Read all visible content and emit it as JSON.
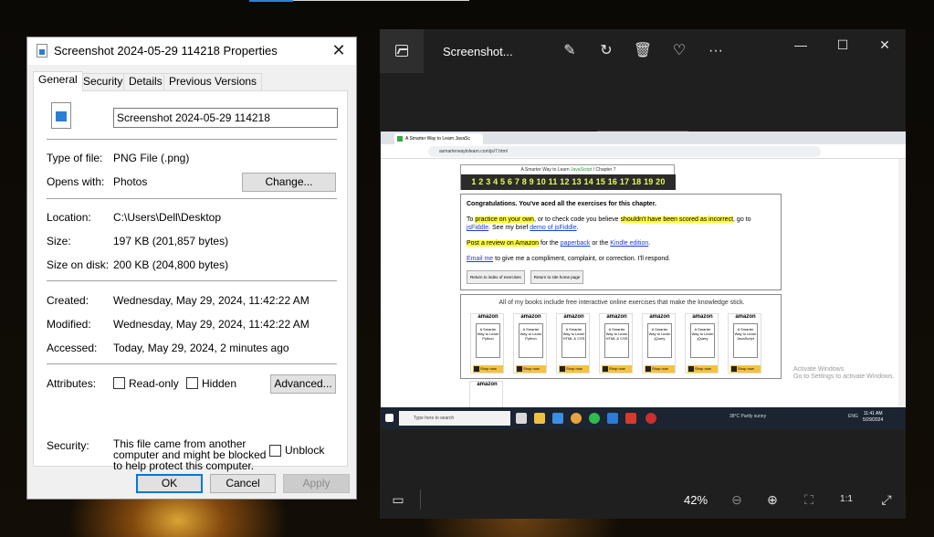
{
  "properties": {
    "title": "Screenshot 2024-05-29 114218 Properties",
    "tabs": [
      "General",
      "Security",
      "Details",
      "Previous Versions"
    ],
    "file_name": "Screenshot 2024-05-29 114218",
    "type_label": "Type of file:",
    "type_value": "PNG File (.png)",
    "opens_label": "Opens with:",
    "opens_value": "Photos",
    "change_label": "Change...",
    "location_label": "Location:",
    "location_value": "C:\\Users\\Dell\\Desktop",
    "size_label": "Size:",
    "size_value": "197 KB (201,857 bytes)",
    "size_disk_label": "Size on disk:",
    "size_disk_value": "200 KB (204,800 bytes)",
    "created_label": "Created:",
    "created_value": "Wednesday, May 29, 2024, 11:42:22 AM",
    "modified_label": "Modified:",
    "modified_value": "Wednesday, May 29, 2024, 11:42:22 AM",
    "accessed_label": "Accessed:",
    "accessed_value": "Today, May 29, 2024, 2 minutes ago",
    "attributes_label": "Attributes:",
    "readonly_label": "Read-only",
    "hidden_label": "Hidden",
    "advanced_label": "Advanced...",
    "security_label": "Security:",
    "security_text": "This file came from another computer and might be blocked to help protect this computer.",
    "unblock_label": "Unblock",
    "ok_label": "OK",
    "cancel_label": "Cancel",
    "apply_label": "Apply",
    "close_glyph": "✕"
  },
  "photos": {
    "title": "Screenshot...",
    "zoom": "42%",
    "window_controls": [
      "—",
      "☐",
      "✕"
    ],
    "toolbar_glyphs": {
      "edit": "✎",
      "rotate": "↻",
      "delete": "🗑",
      "favorite": "♡",
      "more": "···"
    },
    "bottom_glyphs": {
      "filmstrip": "▭",
      "zoom_out": "⊖",
      "zoom_in": "⊕",
      "fit": "⛶",
      "actual": "1:1",
      "fullscreen": "⤢"
    }
  },
  "screenshot": {
    "tab_title": "A Smarter Way to Learn JavaSc",
    "address": "asmarterwaytolearn.com/js/7.html",
    "site_title_prefix": "A Smarter Way to Learn ",
    "site_title_lang": "JavaScript",
    "site_title_suffix": " / Chapter 7",
    "chapter_numbers": "1 2 3 4 5 6 7 8 9 10 11 12 13 14 15 16 17 18 19 20",
    "congrats_heading": "Congratulations. You've aced all the exercises for this chapter.",
    "p1_a": "To ",
    "p1_hl1": "practice on your own",
    "p1_b": ", or to check code you believe ",
    "p1_hl2": "shouldn't have been scored as incorrect",
    "p1_c": ", go to ",
    "p1_link1": "jsFiddle",
    "p1_d": ". See my brief ",
    "p1_link2": "demo of jsFiddle",
    "p1_e": ".",
    "p2_hl": "Post a review on Amazon",
    "p2_a": " for the ",
    "p2_link1": "paperback",
    "p2_b": " or the ",
    "p2_link2": "Kindle edition",
    "p2_c": ".",
    "p3_link": "Email me",
    "p3_a": " to give me a compliment, complaint, or correction. I'll respond.",
    "btn_index": "Return to index of exercises",
    "btn_home": "Return to site home page",
    "books_title": "All of my books include free interactive online exercises that make the knowledge stick.",
    "books": [
      {
        "logo": "amazon",
        "cover": "A Smarter Way to Learn Python",
        "shop": "Shop now"
      },
      {
        "logo": "amazon",
        "cover": "A Smarter Way to Learn Python",
        "shop": "Shop now"
      },
      {
        "logo": "amazon",
        "cover": "A Smarter Way to Learn HTML & CSS",
        "shop": "Shop now"
      },
      {
        "logo": "amazon",
        "cover": "A Smarter Way to Learn HTML & CSS",
        "shop": "Shop now"
      },
      {
        "logo": "amazon",
        "cover": "A Smarter Way to Learn jQuery",
        "shop": "Shop now"
      },
      {
        "logo": "amazon",
        "cover": "A Smarter Way to Learn jQuery",
        "shop": "Shop now"
      },
      {
        "logo": "amazon",
        "cover": "A Smarter Way to Learn JavaScript",
        "shop": "Shop now"
      }
    ],
    "extra_book_logo": "amazon",
    "activate_line1": "Activate Windows",
    "activate_line2": "Go to Settings to activate Windows.",
    "taskbar_search": "Type here to search",
    "weather": "38°C  Partly sunny",
    "lang": "ENG",
    "time": "11:41 AM",
    "date": "5/29/2024"
  }
}
